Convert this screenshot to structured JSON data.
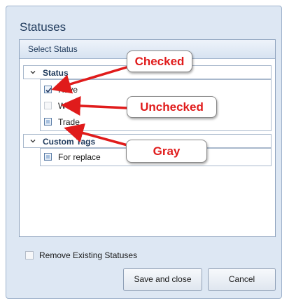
{
  "dialog": {
    "title": "Statuses"
  },
  "panel": {
    "header": "Select Status",
    "groups": [
      {
        "label": "Status",
        "items": [
          {
            "label": "Have",
            "state": "checked"
          },
          {
            "label": "W",
            "state": "unchecked"
          },
          {
            "label": "Trade",
            "state": "gray"
          }
        ]
      },
      {
        "label": "Custom Tags",
        "items": [
          {
            "label": "For replace",
            "state": "gray"
          }
        ]
      }
    ]
  },
  "remove_existing": {
    "label": "Remove Existing Statuses",
    "checked": false
  },
  "buttons": {
    "save": "Save and close",
    "cancel": "Cancel"
  },
  "callouts": {
    "checked": "Checked",
    "unchecked": "Unchecked",
    "gray": "Gray"
  },
  "colors": {
    "callout_text": "#e01b1b",
    "arrow": "#e01b1b",
    "dialog_bg": "#dde7f3",
    "title_text": "#1e395b"
  },
  "icons": {
    "expander": "chevron-down-icon",
    "checkmark": "check-icon"
  }
}
